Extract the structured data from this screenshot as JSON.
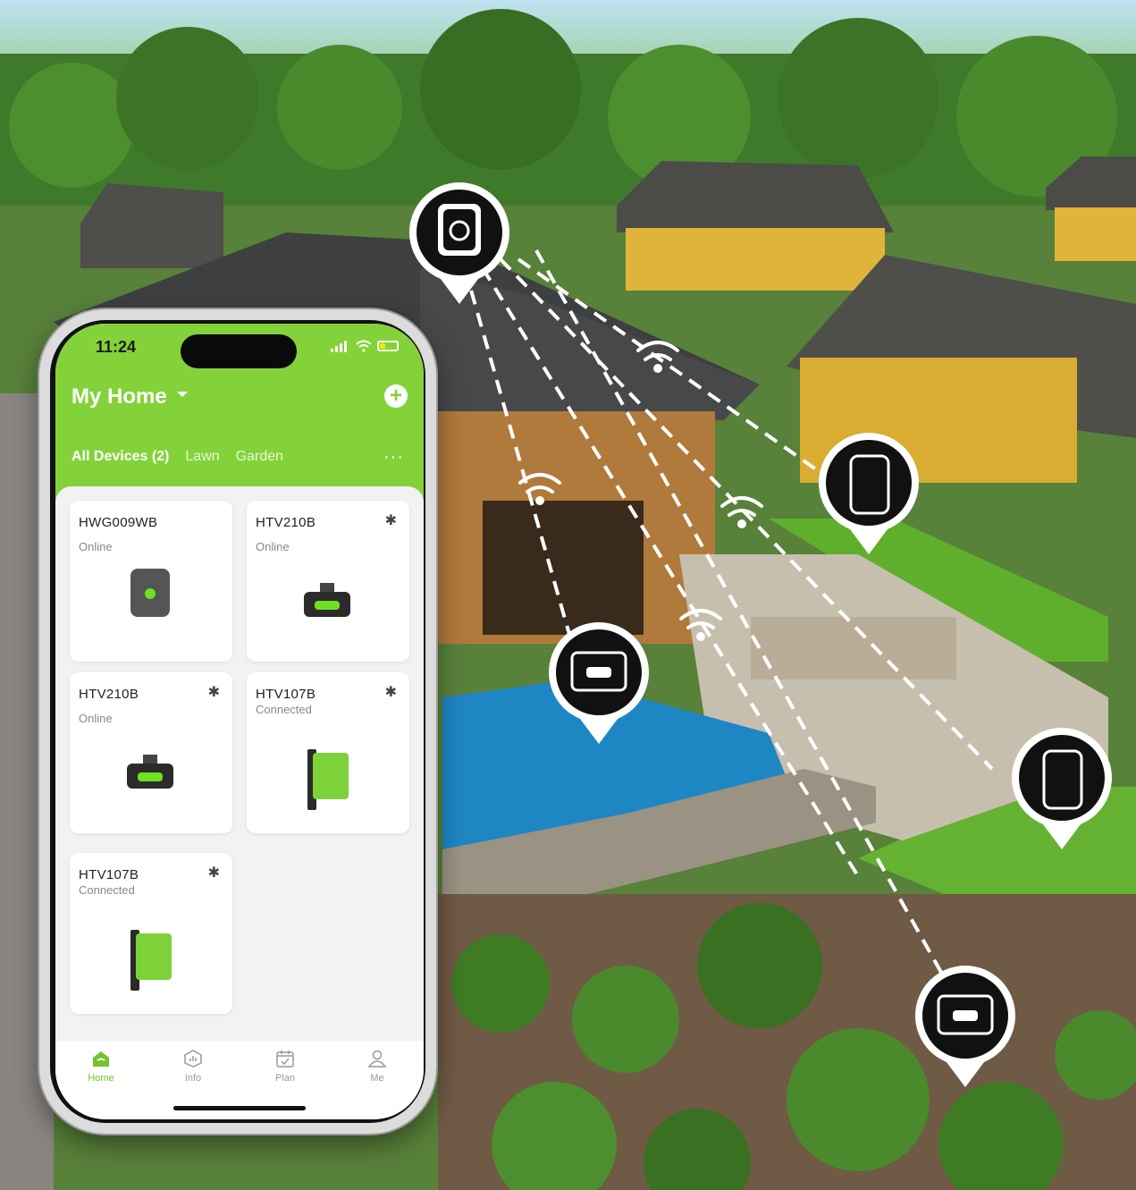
{
  "status_bar": {
    "time": "11:24"
  },
  "header": {
    "home_title": "My Home",
    "add_label": "+"
  },
  "tabs": [
    {
      "label": "All Devices (2)"
    },
    {
      "label": "Lawn"
    },
    {
      "label": "Garden"
    }
  ],
  "more_label": "···",
  "devices": [
    {
      "name": "HWG009WB",
      "status": "Online",
      "bluetooth": ""
    },
    {
      "name": "HTV210B",
      "status": "Online",
      "bluetooth": "✱"
    },
    {
      "name": "HTV210B",
      "status": "Online",
      "bluetooth": "✱"
    },
    {
      "name": "HTV107B",
      "status": "Connected",
      "bluetooth": "✱"
    },
    {
      "name": "HTV107B",
      "status": "Connected",
      "bluetooth": "✱"
    }
  ],
  "nav": [
    {
      "label": "Home",
      "icon": "home-icon"
    },
    {
      "label": "Info",
      "icon": "info-icon"
    },
    {
      "label": "Plan",
      "icon": "calendar-icon"
    },
    {
      "label": "Me",
      "icon": "user-icon"
    }
  ],
  "colors": {
    "accent": "#84d23a",
    "device_green": "#6ee021"
  }
}
